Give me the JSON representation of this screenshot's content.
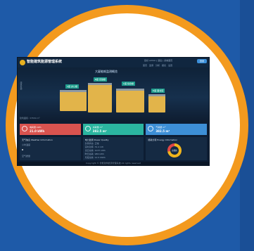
{
  "header": {
    "app_title": "智能建筑能源管理系统",
    "user_info": "您好 admin | 退出 | 系统首页",
    "login": "登录",
    "toolbar": [
      "首页",
      "监测",
      "分析",
      "报表",
      "设置"
    ]
  },
  "hero": {
    "title": "大厦能耗监测概览",
    "side_text": "建筑名称",
    "footer_text": "建筑面积: 37830 m²",
    "labels": [
      "A座 办公楼",
      "B座 实验楼",
      "C座 综合楼",
      "D座 图书馆"
    ]
  },
  "cards": [
    {
      "line1": "电耗量 kWh",
      "line2": "21.0 kWh"
    },
    {
      "line1": "水耗量 m³",
      "line2": "382.5 m³"
    },
    {
      "line1": "气耗量 m³",
      "line2": "382.5 m³"
    }
  ],
  "panels": [
    {
      "title": "天气信息 Weather Information",
      "rows": [
        "小时温度",
        "8",
        "空气质量"
      ]
    },
    {
      "title": "电力监测 Power Quality",
      "rows": [
        "负荷状态: 正常",
        "实时功率: 31.2 kW",
        "当日总耗: 1037 kWh",
        "昨日总耗: 986 kWh",
        "月度总耗: 12.5 MWh"
      ]
    },
    {
      "title": "能耗分项 Energy Information",
      "rows": [
        "总能耗"
      ]
    }
  ],
  "donut": {
    "segments": [
      0.72,
      0.28
    ],
    "colors": [
      "#f1b51c",
      "#e04646"
    ]
  },
  "footer": "Copyright © 智能建筑能源管理系统 All rights reserved",
  "colors": {
    "ring": "#f39a1e",
    "background": "#1e5aa8",
    "screen": "#0d1d33"
  }
}
